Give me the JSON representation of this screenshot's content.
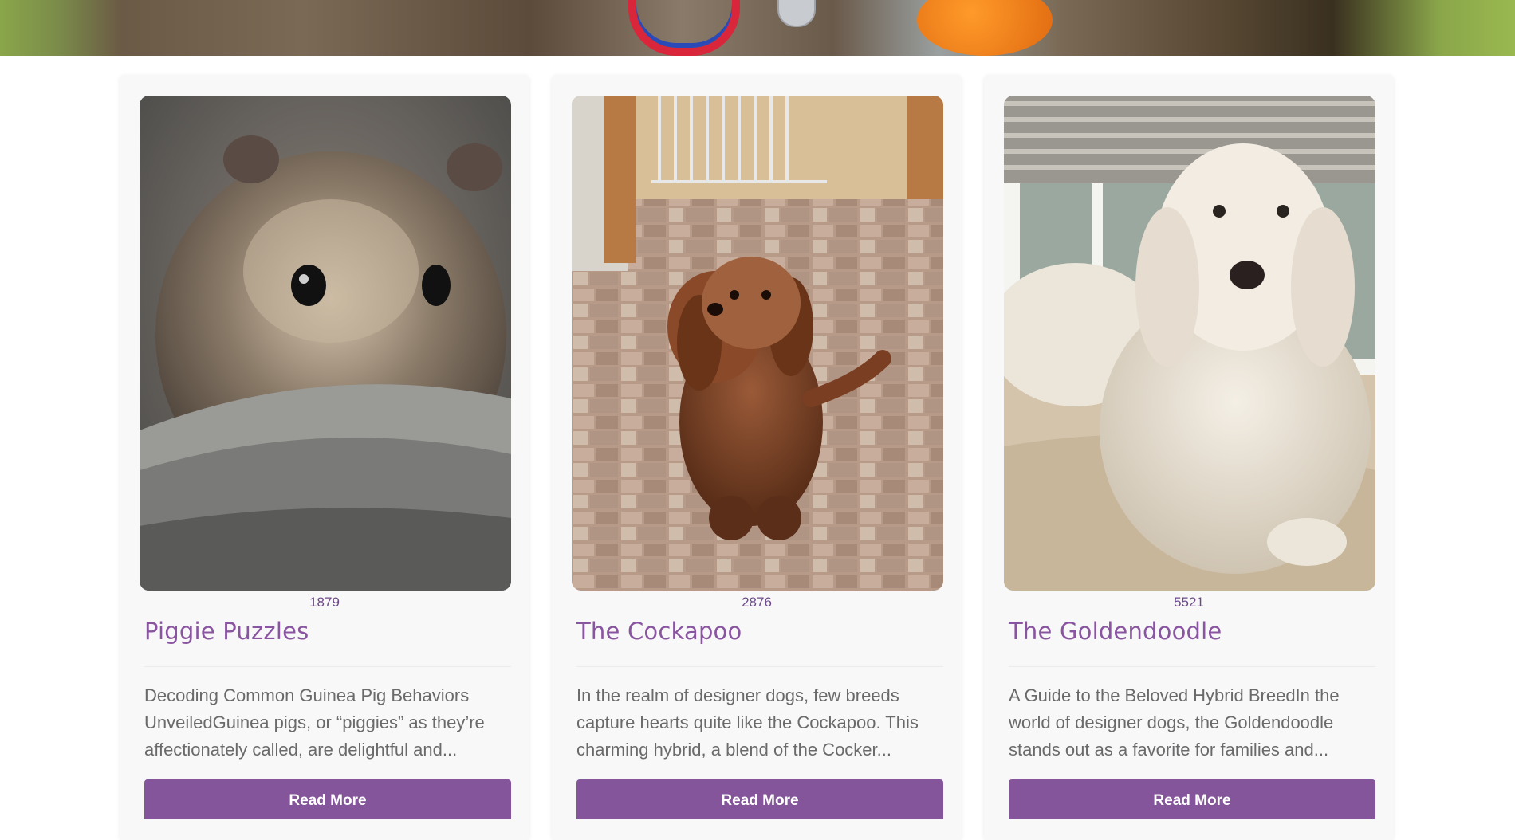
{
  "cards": [
    {
      "views": "1879",
      "title": "Piggie Puzzles",
      "excerpt": "Decoding Common Guinea Pig Behaviors UnveiledGuinea pigs, or “piggies” as they’re affectionately called, are delightful and...",
      "button_label": "Read More",
      "image_subject": "guinea-pig-photo"
    },
    {
      "views": "2876",
      "title": "The Cockapoo",
      "excerpt": "In the realm of designer dogs, few breeds capture hearts quite like the Cockapoo. This charming hybrid, a blend of the Cocker...",
      "button_label": "Read More",
      "image_subject": "cockapoo-photo"
    },
    {
      "views": "5521",
      "title": "The Goldendoodle",
      "excerpt": "A Guide to the Beloved Hybrid BreedIn the world of designer dogs, the Goldendoodle stands out as a favorite for families and...",
      "button_label": "Read More",
      "image_subject": "goldendoodle-photo"
    }
  ],
  "colors": {
    "accent": "#84559a",
    "title": "#8a55a0",
    "views": "#6c4a8a",
    "text": "#6a6a6a",
    "card_bg": "#f8f8f9"
  }
}
